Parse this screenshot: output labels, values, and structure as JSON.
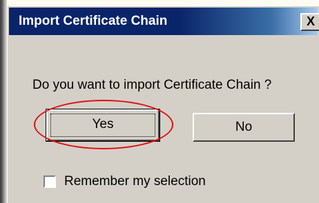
{
  "dialog": {
    "title": "Import Certificate Chain",
    "close_glyph": "X",
    "question": "Do you want to import Certificate Chain ?",
    "yes_label": "Yes",
    "no_label": "No",
    "remember_label": "Remember my selection",
    "remember_checked": false
  },
  "colors": {
    "titlebar_start": "#0a246a",
    "titlebar_end": "#a6caf0",
    "face": "#d4d0c8",
    "highlight": "#e01010"
  },
  "icons": {
    "close": "close-icon",
    "highlight": "red-ellipse-annotation"
  }
}
